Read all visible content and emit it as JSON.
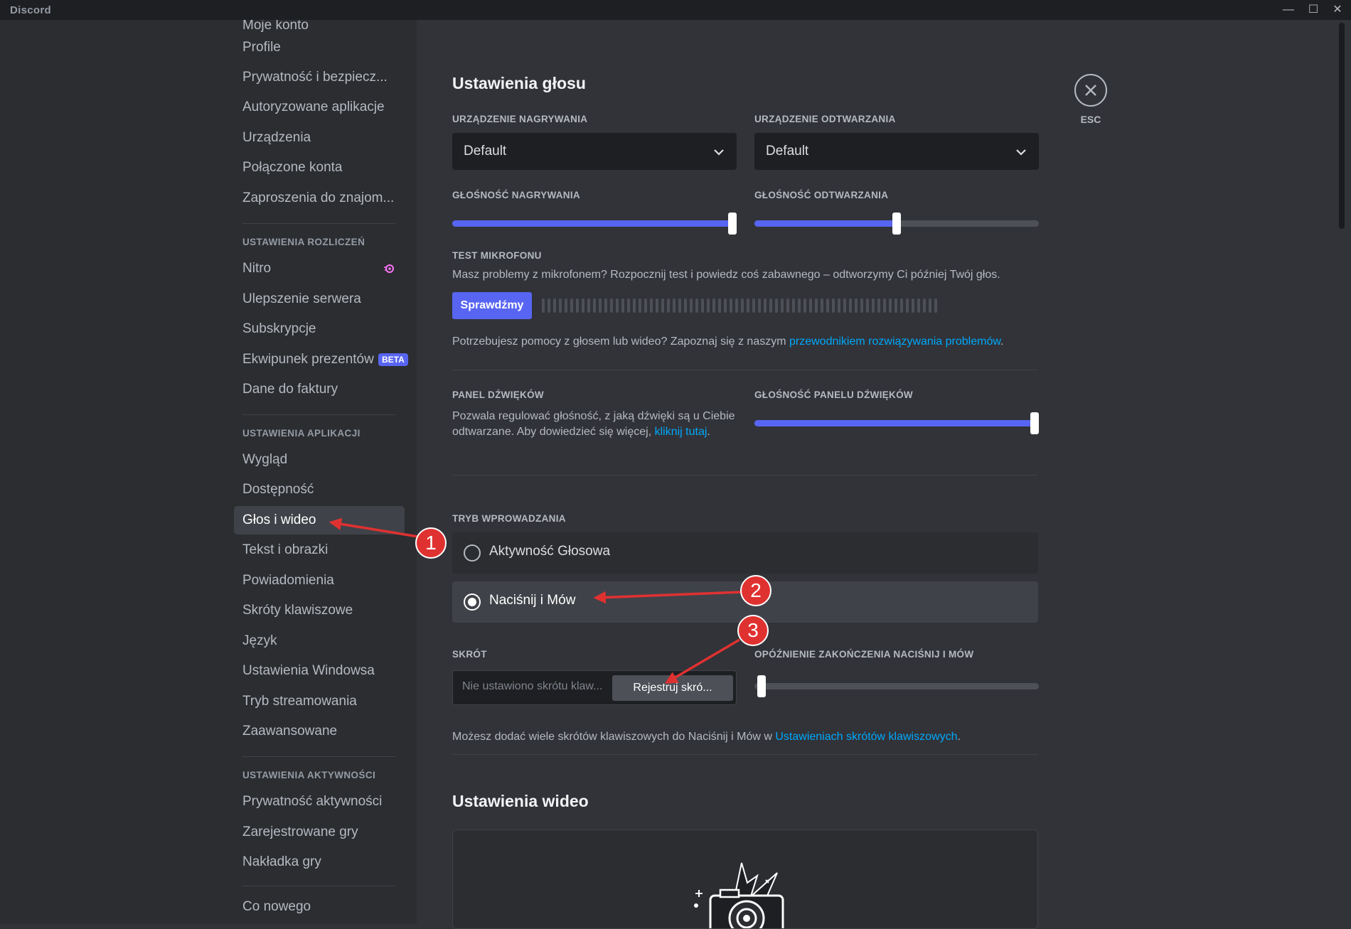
{
  "window": {
    "app_name": "Discord",
    "controls": [
      "—",
      "☐",
      "✕"
    ]
  },
  "sidebar": {
    "top_cut_item": "Moje konto",
    "user_items": [
      "Profile",
      "Prywatność i bezpiecz...",
      "Autoryzowane aplikacje",
      "Urządzenia",
      "Połączone konta",
      "Zaproszenia do znajom..."
    ],
    "billing_header": "USTAWIENIA ROZLICZEŃ",
    "billing_items": [
      "Nitro",
      "Ulepszenie serwera",
      "Subskrypcje",
      "Ekwipunek prezentów",
      "Dane do faktury"
    ],
    "beta_badge": "BETA",
    "app_header": "USTAWIENIA APLIKACJI",
    "app_items": [
      "Wygląd",
      "Dostępność",
      "Głos i wideo",
      "Tekst i obrazki",
      "Powiadomienia",
      "Skróty klawiszowe",
      "Język",
      "Ustawienia Windowsa",
      "Tryb streamowania",
      "Zaawansowane"
    ],
    "activity_header": "USTAWIENIA AKTYWNOŚCI",
    "activity_items": [
      "Prywatność aktywności",
      "Zarejestrowane gry",
      "Nakładka gry"
    ],
    "bottom_items": [
      "Co nowego"
    ]
  },
  "voice": {
    "title": "Ustawienia głosu",
    "input_device_label": "URZĄDZENIE NAGRYWANIA",
    "input_device_value": "Default",
    "output_device_label": "URZĄDZENIE ODTWARZANIA",
    "output_device_value": "Default",
    "input_volume_label": "GŁOŚNOŚĆ NAGRYWANIA",
    "input_volume_fraction": 1.0,
    "output_volume_label": "GŁOŚNOŚĆ ODTWARZANIA",
    "output_volume_fraction": 0.5,
    "mic_test_label": "TEST MIKROFONU",
    "mic_test_desc": "Masz problemy z mikrofonem? Rozpocznij test i powiedz coś zabawnego – odtworzymy Ci później Twój głos.",
    "mic_test_button": "Sprawdźmy",
    "help_text": "Potrzebujesz pomocy z głosem lub wideo? Zapoznaj się z naszym ",
    "help_link": "przewodnikiem rozwiązywania problemów",
    "help_end": ".",
    "soundboard_label": "PANEL DŹWIĘKÓW",
    "soundboard_desc": "Pozwala regulować głośność, z jaką dźwięki są u Ciebie odtwarzane. Aby dowiedzieć się więcej, ",
    "soundboard_link": "kliknij tutaj",
    "soundboard_end": ".",
    "soundboard_volume_label": "GŁOŚNOŚĆ PANELU DŹWIĘKÓW",
    "soundboard_volume_fraction": 1.0,
    "input_mode_label": "TRYB WPROWADZANIA",
    "mode_voice_activity": "Aktywność Głosowa",
    "mode_ptt": "Naciśnij i Mów",
    "shortcut_label": "SKRÓT",
    "shortcut_placeholder": "Nie ustawiono skrótu klaw...",
    "shortcut_button": "Rejestruj skró...",
    "ptt_delay_label": "OPÓŹNIENIE ZAKOŃCZENIA NACIŚNIJ I MÓW",
    "ptt_delay_fraction": 0.0,
    "keybind_note": "Możesz dodać wiele skrótów klawiszowych do Naciśnij i Mów w ",
    "keybind_link": "Ustawieniach skrótów klawiszowych",
    "keybind_end": "."
  },
  "video": {
    "title": "Ustawienia wideo"
  },
  "close": {
    "label": "ESC"
  },
  "annotations": [
    "1",
    "2",
    "3"
  ],
  "colors": {
    "accent": "#5865f2",
    "link": "#00a8fc",
    "annotation": "#e03131"
  }
}
